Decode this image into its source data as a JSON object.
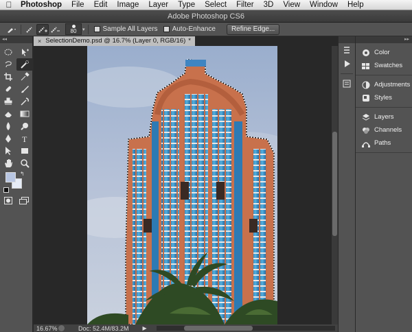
{
  "menubar": {
    "items": [
      "Photoshop",
      "File",
      "Edit",
      "Image",
      "Layer",
      "Type",
      "Select",
      "Filter",
      "3D",
      "View",
      "Window",
      "Help"
    ]
  },
  "window": {
    "title": "Adobe Photoshop CS6"
  },
  "options": {
    "brush_size": "80",
    "sample_all_layers": "Sample All Layers",
    "auto_enhance": "Auto-Enhance",
    "refine_edge": "Refine Edge..."
  },
  "document": {
    "tab_label": "SelectionDemo.psd @ 16.7% (Layer 0, RGB/16)",
    "tab_marker": "*",
    "close_symbol": "×"
  },
  "status": {
    "zoom": "16.67%",
    "doc_size": "Doc: 52.4M/83.2M"
  },
  "panels": {
    "group1": [
      "Color",
      "Swatches"
    ],
    "group2": [
      "Adjustments",
      "Styles"
    ],
    "group3": [
      "Layers",
      "Channels",
      "Paths"
    ]
  },
  "colors": {
    "foreground": "#b8c6e2",
    "background": "#e6ecf7",
    "ui_dark": "#535353",
    "tower": "#c8714c",
    "glass": "#3a8fc4",
    "sky": "#aab8d4"
  }
}
